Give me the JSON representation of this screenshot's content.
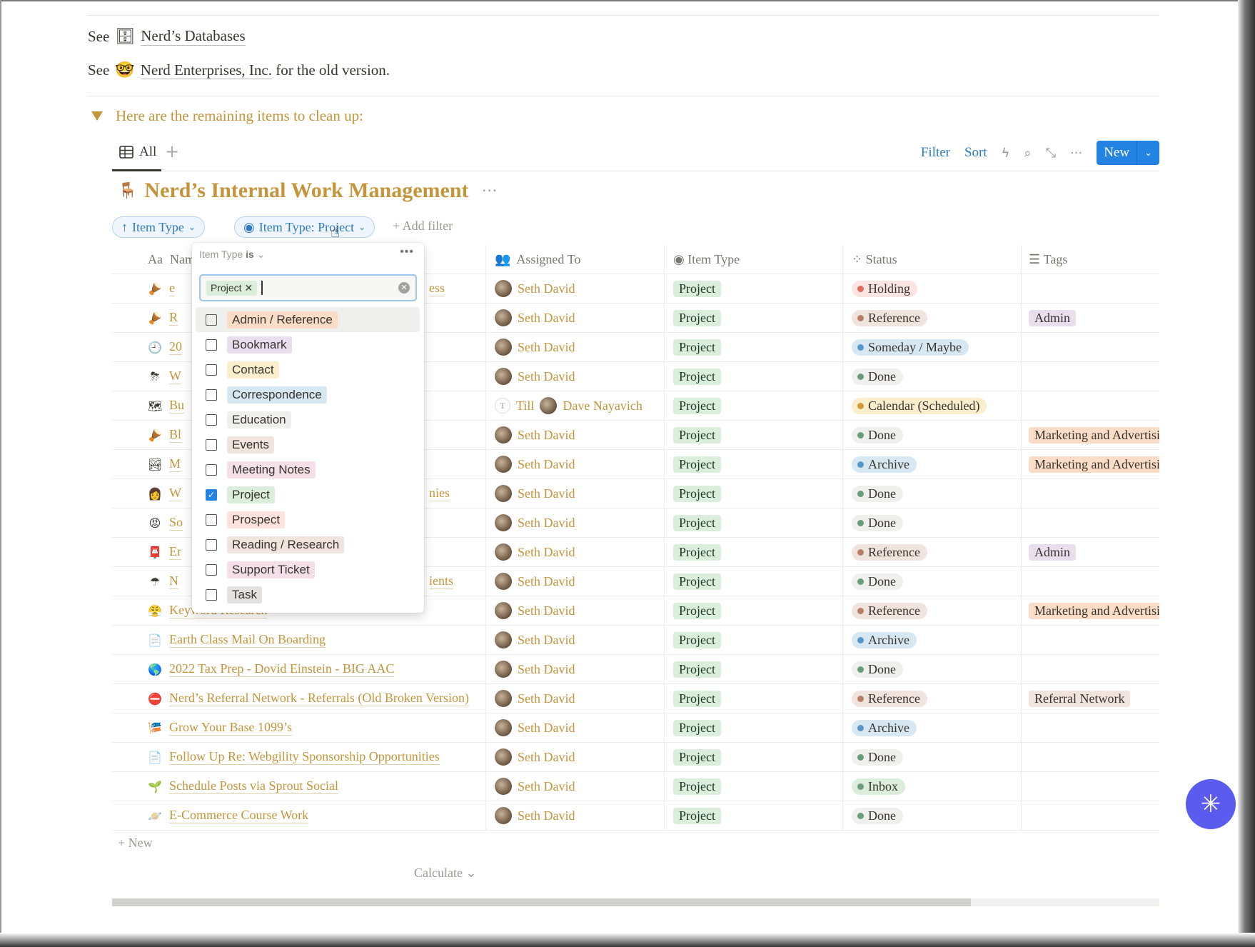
{
  "links": [
    {
      "prefix": "See",
      "icon": "database-icon",
      "glyph": "🗄",
      "text": "Nerd’s Databases",
      "suffix": ""
    },
    {
      "prefix": "See",
      "icon": "nerd-face-icon",
      "glyph": "🤓",
      "text": "Nerd Enterprises, Inc.",
      "suffix": " for the old version."
    }
  ],
  "toggle": {
    "label": "Here are the remaining items to clean up:"
  },
  "view": {
    "tab_label": "All",
    "add": "+",
    "filter": "Filter",
    "sort": "Sort",
    "new": "New"
  },
  "database": {
    "title": "Nerd’s Internal Work Management",
    "more": "···"
  },
  "sort_chip": {
    "label": "Item Type"
  },
  "filter_chip": {
    "label": "Item Type: Project"
  },
  "add_filter": "Add filter",
  "columns": {
    "name": "Name",
    "assigned": "Assigned To",
    "item_type": "Item Type",
    "status": "Status",
    "tags": "Tags",
    "name_prefix": "Aa"
  },
  "rows": [
    {
      "icon": "🪘",
      "name": "e",
      "tail": "ess",
      "assigned": [
        "Seth David"
      ],
      "type": "Project",
      "status": "Holding",
      "status_color": "#e16b5e",
      "status_bg": "#fbe4e1",
      "tag": ""
    },
    {
      "icon": "🪘",
      "name": "R",
      "tail": "",
      "assigned": [
        "Seth David"
      ],
      "type": "Project",
      "status": "Reference",
      "status_color": "#b8806a",
      "status_bg": "#f1e3dd",
      "tag": "Admin",
      "tag_bg": "#e8deee"
    },
    {
      "icon": "🕘",
      "name": "20",
      "tail": "",
      "assigned": [
        "Seth David"
      ],
      "type": "Project",
      "status": "Someday / Maybe",
      "status_color": "#5a97c9",
      "status_bg": "#d8e8f3",
      "tag": ""
    },
    {
      "icon": "⛈",
      "name": "W",
      "tail": "",
      "assigned": [
        "Seth David"
      ],
      "type": "Project",
      "status": "Done",
      "status_color": "#6c9b7d",
      "status_bg": "#efefed",
      "tag": ""
    },
    {
      "icon": "🗺",
      "name": "Bu",
      "tail": "",
      "assigned": [
        "Till",
        "Dave Nayavich"
      ],
      "type": "Project",
      "status": "Calendar (Scheduled)",
      "status_color": "#d39a35",
      "status_bg": "#fbeecd",
      "tag": ""
    },
    {
      "icon": "🪘",
      "name": "Bl",
      "tail": "",
      "assigned": [
        "Seth David"
      ],
      "type": "Project",
      "status": "Done",
      "status_color": "#6c9b7d",
      "status_bg": "#efefed",
      "tag": "Marketing and Advertising",
      "tag_bg": "#fbdcc6"
    },
    {
      "icon": "🏞",
      "name": "M",
      "tail": "",
      "assigned": [
        "Seth David"
      ],
      "type": "Project",
      "status": "Archive",
      "status_color": "#5a97c9",
      "status_bg": "#d8e8f3",
      "tag": "Marketing and Advertising",
      "tag_bg": "#fbdcc6"
    },
    {
      "icon": "👩",
      "name": "W",
      "tail": "nies",
      "assigned": [
        "Seth David"
      ],
      "type": "Project",
      "status": "Done",
      "status_color": "#6c9b7d",
      "status_bg": "#efefed",
      "tag": ""
    },
    {
      "icon": "😡",
      "name": "So",
      "tail": "",
      "assigned": [
        "Seth David"
      ],
      "type": "Project",
      "status": "Done",
      "status_color": "#6c9b7d",
      "status_bg": "#efefed",
      "tag": ""
    },
    {
      "icon": "📮",
      "name": "Er",
      "tail": "",
      "assigned": [
        "Seth David"
      ],
      "type": "Project",
      "status": "Reference",
      "status_color": "#b8806a",
      "status_bg": "#f1e3dd",
      "tag": "Admin",
      "tag_bg": "#e8deee"
    },
    {
      "icon": "☂",
      "name": "N",
      "tail": "ients",
      "assigned": [
        "Seth David"
      ],
      "type": "Project",
      "status": "Done",
      "status_color": "#6c9b7d",
      "status_bg": "#efefed",
      "tag": ""
    },
    {
      "icon": "😤",
      "name": "Keyword Research",
      "tail": "",
      "assigned": [
        "Seth David"
      ],
      "type": "Project",
      "status": "Reference",
      "status_color": "#b8806a",
      "status_bg": "#f1e3dd",
      "tag": "Marketing and Advertising",
      "tag_bg": "#fbdcc6"
    },
    {
      "icon": "📄",
      "name": "Earth Class Mail On Boarding",
      "tail": "",
      "assigned": [
        "Seth David"
      ],
      "type": "Project",
      "status": "Archive",
      "status_color": "#5a97c9",
      "status_bg": "#d8e8f3",
      "tag": ""
    },
    {
      "icon": "🌎",
      "name": "2022 Tax Prep - Dovid Einstein - BIG AAC",
      "tail": "",
      "assigned": [
        "Seth David"
      ],
      "type": "Project",
      "status": "Done",
      "status_color": "#6c9b7d",
      "status_bg": "#efefed",
      "tag": ""
    },
    {
      "icon": "⛔",
      "name": "Nerd’s Referral Network - Referrals (Old Broken Version)",
      "tail": "",
      "assigned": [
        "Seth David"
      ],
      "type": "Project",
      "status": "Reference",
      "status_color": "#b8806a",
      "status_bg": "#f1e3dd",
      "tag": "Referral Network",
      "tag_bg": "#f1e3dd"
    },
    {
      "icon": "🎏",
      "name": "Grow Your Base 1099’s",
      "tail": "",
      "assigned": [
        "Seth David"
      ],
      "type": "Project",
      "status": "Archive",
      "status_color": "#5a97c9",
      "status_bg": "#d8e8f3",
      "tag": ""
    },
    {
      "icon": "📄",
      "name": "Follow Up Re: Webgility Sponsorship Opportunities",
      "tail": "",
      "assigned": [
        "Seth David"
      ],
      "type": "Project",
      "status": "Done",
      "status_color": "#6c9b7d",
      "status_bg": "#efefed",
      "tag": ""
    },
    {
      "icon": "🌱",
      "name": "Schedule Posts via Sprout Social",
      "tail": "",
      "assigned": [
        "Seth David"
      ],
      "type": "Project",
      "status": "Inbox",
      "status_color": "#6c9b7d",
      "status_bg": "#dbeddb",
      "tag": ""
    },
    {
      "icon": "🪐",
      "name": "E-Commerce Course Work",
      "tail": "",
      "assigned": [
        "Seth David"
      ],
      "type": "Project",
      "status": "Done",
      "status_color": "#6c9b7d",
      "status_bg": "#efefed",
      "tag": ""
    }
  ],
  "new_row": "New",
  "calculate": "Calculate",
  "scroll_fraction": 0.82,
  "popup": {
    "property": "Item Type",
    "operator": "is",
    "more": "•••",
    "selected_tag": "Project",
    "options": [
      {
        "label": "Admin / Reference",
        "bg": "#fbdcc6",
        "checked": false
      },
      {
        "label": "Bookmark",
        "bg": "#e8deee",
        "checked": false
      },
      {
        "label": "Contact",
        "bg": "#fbeecd",
        "checked": false
      },
      {
        "label": "Correspondence",
        "bg": "#d8e8f3",
        "checked": false
      },
      {
        "label": "Education",
        "bg": "#efefed",
        "checked": false
      },
      {
        "label": "Events",
        "bg": "#f1e3dd",
        "checked": false
      },
      {
        "label": "Meeting Notes",
        "bg": "#f5e0e9",
        "checked": false
      },
      {
        "label": "Project",
        "bg": "#dbeddb",
        "checked": true
      },
      {
        "label": "Prospect",
        "bg": "#ffe2dd",
        "checked": false
      },
      {
        "label": "Reading / Research",
        "bg": "#f1e3dd",
        "checked": false
      },
      {
        "label": "Support Ticket",
        "bg": "#f5e0e9",
        "checked": false
      },
      {
        "label": "Task",
        "bg": "#e3e2e0",
        "checked": false
      }
    ]
  }
}
